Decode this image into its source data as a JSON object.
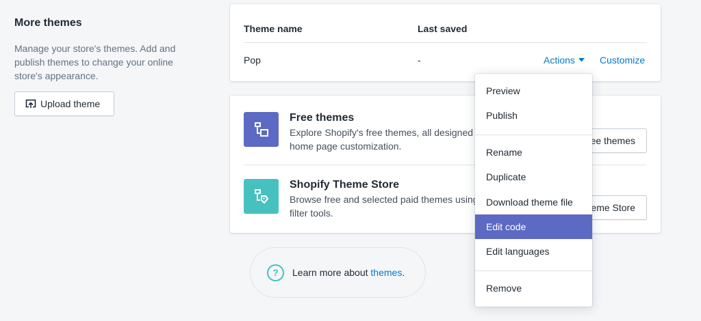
{
  "left_panel": {
    "title": "More themes",
    "description": "Manage your store's themes. Add and publish themes to change your online store's appearance.",
    "upload_button": "Upload theme",
    "upload_icon": "upload-icon"
  },
  "theme_table": {
    "headers": {
      "name": "Theme name",
      "saved": "Last saved"
    },
    "rows": [
      {
        "name": "Pop",
        "saved": "-",
        "actions_label": "Actions",
        "customize_label": "Customize"
      }
    ]
  },
  "theme_sources": [
    {
      "title": "Free themes",
      "description": "Explore Shopify's free themes, all designed to offer the best home page customization.",
      "button": "Explore free themes",
      "icon": "free-themes-icon",
      "icon_color": "#5c6ac4"
    },
    {
      "title": "Shopify Theme Store",
      "description": "Browse free and selected paid themes using search and filter tools.",
      "button": "Visit Theme Store",
      "icon": "theme-store-icon",
      "icon_color": "#47c1bf"
    }
  ],
  "learn_more": {
    "prefix": "Learn more about ",
    "link": "themes",
    "suffix": ".",
    "icon": "help-icon"
  },
  "actions_menu": {
    "items": [
      "Preview",
      "Publish",
      "Rename",
      "Duplicate",
      "Download theme file",
      "Edit code",
      "Edit languages",
      "Remove"
    ],
    "active": "Edit code"
  },
  "colors": {
    "accent": "#5c6ac4",
    "link": "#007ace",
    "teal": "#47c1bf"
  }
}
